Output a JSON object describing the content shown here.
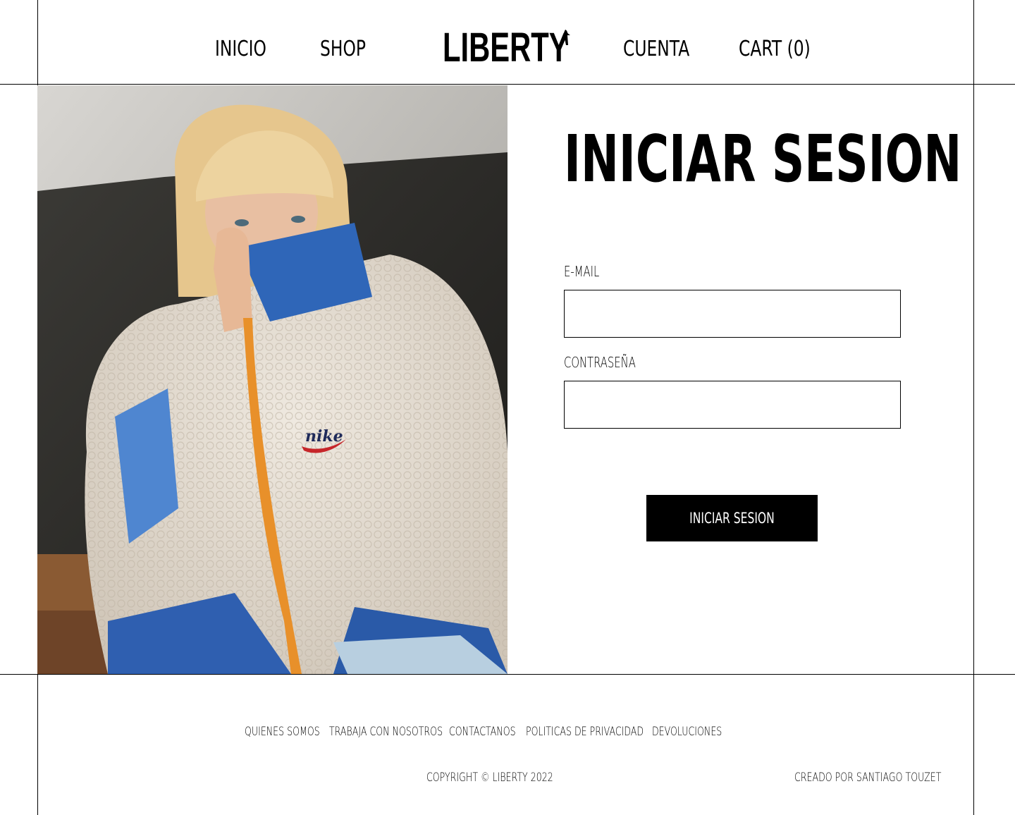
{
  "header": {
    "nav_left": [
      {
        "label": "INICIO"
      },
      {
        "label": "SHOP"
      }
    ],
    "logo": "LIBERTY",
    "nav_right": [
      {
        "label": "CUENTA"
      },
      {
        "label": "CART (0)"
      }
    ]
  },
  "hero": {
    "icon": "nike-logo-icon",
    "jacket_text": "nike"
  },
  "login": {
    "title": "INICIAR SESION",
    "email_label": "E-MAIL",
    "email_value": "",
    "password_label": "CONTRASEÑA",
    "password_value": "",
    "submit_label": "INICIAR SESION"
  },
  "footer": {
    "links": [
      {
        "label": "QUIENES SOMOS"
      },
      {
        "label": "TRABAJA CON NOSOTROS"
      },
      {
        "label": "CONTACTANOS"
      },
      {
        "label": "POLITICAS DE PRIVACIDAD"
      },
      {
        "label": "DEVOLUCIONES"
      }
    ],
    "copyright": "COPYRIGHT © LIBERTY 2022",
    "credit": "CREADO POR SANTIAGO TOUZET"
  },
  "colors": {
    "background": "#ffffff",
    "text": "#000000",
    "button_bg": "#000000",
    "button_text": "#ffffff"
  }
}
